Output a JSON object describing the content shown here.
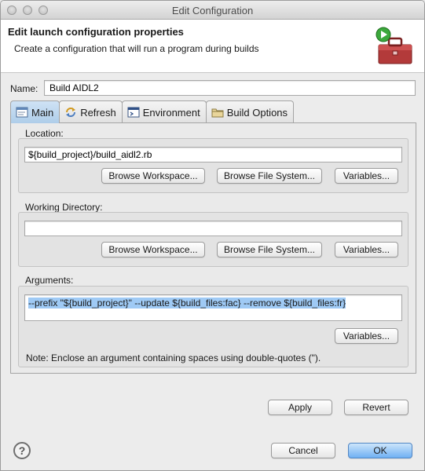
{
  "window": {
    "title": "Edit Configuration"
  },
  "header": {
    "title": "Edit launch configuration properties",
    "description": "Create a configuration that will run a program during builds"
  },
  "name": {
    "label": "Name:",
    "value": "Build AIDL2"
  },
  "tabs": [
    {
      "label": "Main",
      "icon": "main-tab-icon",
      "active": true
    },
    {
      "label": "Refresh",
      "icon": "refresh-icon",
      "active": false
    },
    {
      "label": "Environment",
      "icon": "environment-icon",
      "active": false
    },
    {
      "label": "Build Options",
      "icon": "build-options-icon",
      "active": false
    }
  ],
  "location": {
    "label": "Location:",
    "value": "${build_project}/build_aidl2.rb",
    "browse_workspace": "Browse Workspace...",
    "browse_filesystem": "Browse File System...",
    "variables": "Variables..."
  },
  "working_directory": {
    "label": "Working Directory:",
    "value": "",
    "browse_workspace": "Browse Workspace...",
    "browse_filesystem": "Browse File System...",
    "variables": "Variables..."
  },
  "arguments": {
    "label": "Arguments:",
    "value": "--prefix \"${build_project}\" --update ${build_files:fac} --remove ${build_files:fr}",
    "variables": "Variables...",
    "note": "Note: Enclose an argument containing spaces using double-quotes (\")."
  },
  "actions": {
    "apply": "Apply",
    "revert": "Revert"
  },
  "footer": {
    "cancel": "Cancel",
    "ok": "OK"
  },
  "colors": {
    "accent": "#6fb0f3",
    "selection": "#9fcaf5",
    "active_tab": "#aecde9"
  }
}
